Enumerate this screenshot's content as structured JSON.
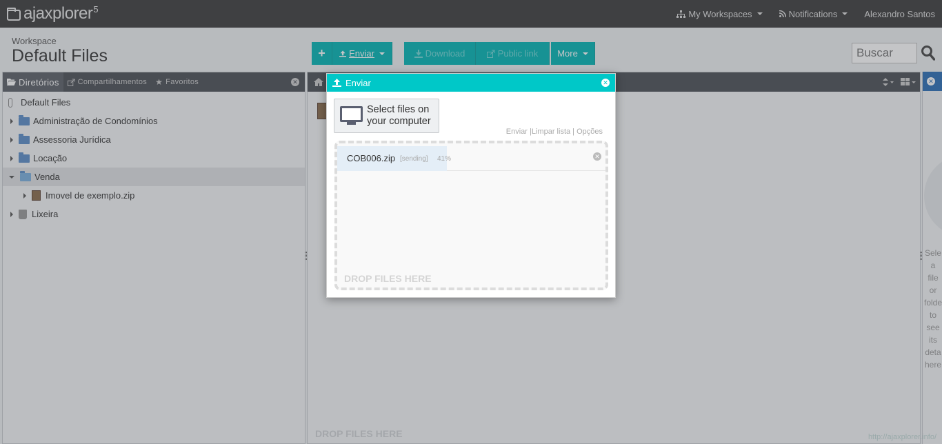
{
  "app": {
    "name": "ajaxplorer",
    "version": "5"
  },
  "topnav": {
    "workspaces": "My Workspaces",
    "notifications": "Notifications",
    "user": "Alexandro Santos"
  },
  "header": {
    "workspace_label": "Workspace",
    "workspace_title": "Default Files"
  },
  "toolbar": {
    "add": "+",
    "upload": "Enviar",
    "download": "Download",
    "public_link": "Public link",
    "more": "More"
  },
  "search": {
    "placeholder": "Buscar"
  },
  "left_panel": {
    "tabs": [
      "Diretórios",
      "Compartilhamentos",
      "Favoritos"
    ],
    "tree": {
      "root": "Default Files",
      "items": [
        "Administração de Condomínios",
        "Assessoria Jurídica",
        "Locação",
        "Venda"
      ],
      "child": "Imovel de exemplo.zip",
      "trash": "Lixeira"
    }
  },
  "main_panel": {
    "drop_text": "DROP FILES HERE"
  },
  "right_panel": {
    "hint_lines": [
      "Sele",
      "a",
      "file",
      "or",
      "folde",
      "to",
      "see",
      "its",
      "deta",
      "here"
    ]
  },
  "modal": {
    "title": "Enviar",
    "select_button": [
      "Select files on",
      "your computer"
    ],
    "links": "Enviar |Limpar lista | Opções",
    "drop_text": "DROP FILES HERE",
    "file": {
      "name": "COB006.zip",
      "status": "[sending]",
      "percent": "41%",
      "progress": 0.41
    }
  },
  "footer": {
    "link": "http://ajaxplorer.info/"
  },
  "colors": {
    "accent": "#00c8c8",
    "toolbar": "#00b4b4",
    "topbar": "#3c3c3c",
    "panel_head": "#4a4e55"
  }
}
